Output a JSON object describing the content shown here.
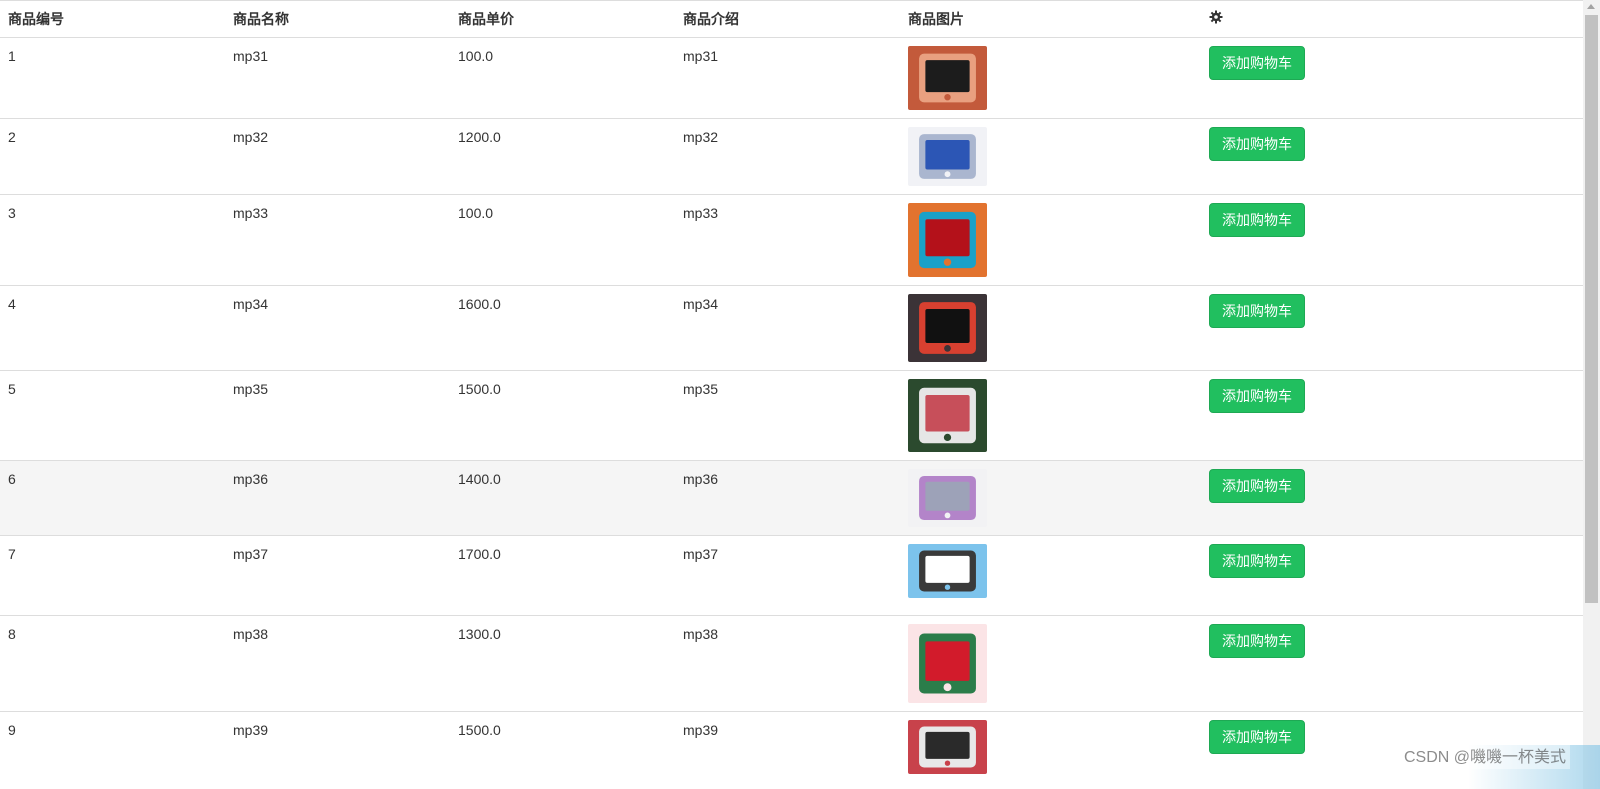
{
  "table": {
    "headers": [
      "商品编号",
      "商品名称",
      "商品单价",
      "商品介绍",
      "商品图片"
    ],
    "action_header_icon": "gear-icon",
    "rows": [
      {
        "id": "1",
        "name": "mp31",
        "price": "100.0",
        "desc": "mp31",
        "button": "添加购物车",
        "img": {
          "h": 64,
          "bg": "#c35a3b",
          "fg": "#1c1c1c",
          "acc": "#e9a080"
        }
      },
      {
        "id": "2",
        "name": "mp32",
        "price": "1200.0",
        "desc": "mp32",
        "button": "添加购物车",
        "img": {
          "h": 59,
          "bg": "#f1f2f6",
          "fg": "#2c56b5",
          "acc": "#aab6cf"
        }
      },
      {
        "id": "3",
        "name": "mp33",
        "price": "100.0",
        "desc": "mp33",
        "button": "添加购物车",
        "img": {
          "h": 74,
          "bg": "#e2732f",
          "fg": "#b4111a",
          "acc": "#1aa1c8"
        }
      },
      {
        "id": "4",
        "name": "mp34",
        "price": "1600.0",
        "desc": "mp34",
        "button": "添加购物车",
        "img": {
          "h": 68,
          "bg": "#3b3337",
          "fg": "#111111",
          "acc": "#d84030"
        }
      },
      {
        "id": "5",
        "name": "mp35",
        "price": "1500.0",
        "desc": "mp35",
        "button": "添加购物车",
        "img": {
          "h": 73,
          "bg": "#2b4a2e",
          "fg": "#c74f5a",
          "acc": "#e6e6e6"
        }
      },
      {
        "id": "6",
        "name": "mp36",
        "price": "1400.0",
        "desc": "mp36",
        "button": "添加购物车",
        "img": {
          "h": 58,
          "bg": "#f2f2f4",
          "fg": "#9da2b8",
          "acc": "#b384c9"
        }
      },
      {
        "id": "7",
        "name": "mp37",
        "price": "1700.0",
        "desc": "mp37",
        "button": "添加购物车",
        "img": {
          "h": 54,
          "bg": "#7cc3ec",
          "fg": "#ffffff",
          "acc": "#3a3a3a"
        }
      },
      {
        "id": "8",
        "name": "mp38",
        "price": "1300.0",
        "desc": "mp38",
        "button": "添加购物车",
        "img": {
          "h": 79,
          "bg": "#fbe4e6",
          "fg": "#d21b2b",
          "acc": "#2b7d4a"
        }
      },
      {
        "id": "9",
        "name": "mp39",
        "price": "1500.0",
        "desc": "mp39",
        "button": "添加购物车",
        "img": {
          "h": 54,
          "bg": "#c8424b",
          "fg": "#2a2a2a",
          "acc": "#e8e8e8"
        }
      }
    ],
    "hovered_row": "6"
  },
  "watermark": "CSDN @嘰嘰一杯美式",
  "colors": {
    "button_bg": "#21bf5f",
    "row_hover": "#f5f5f5",
    "border": "#dddddd"
  }
}
